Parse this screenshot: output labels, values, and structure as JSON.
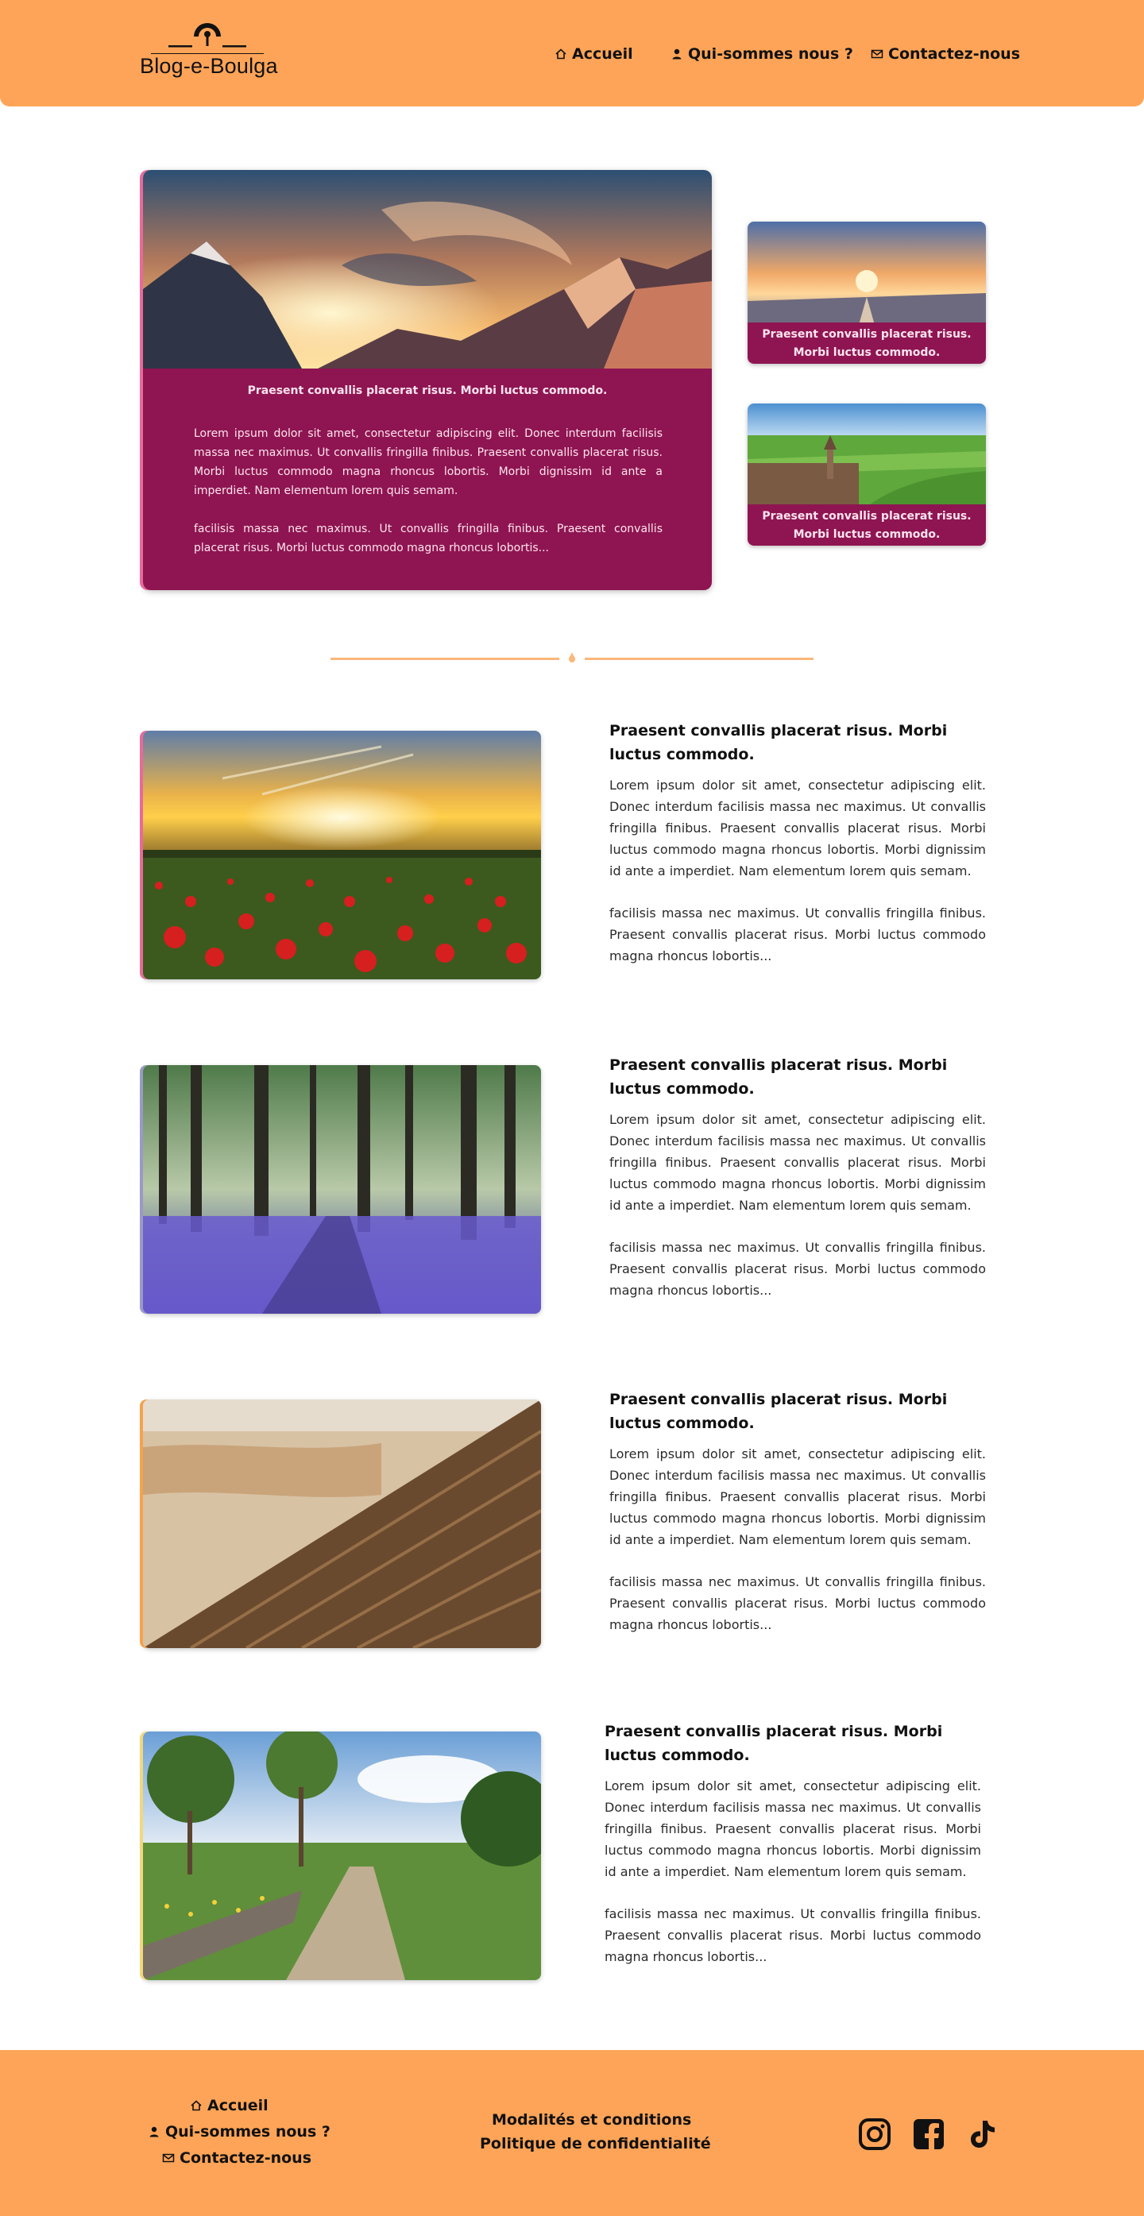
{
  "header": {
    "logo_text": "Blog-e-Boulga",
    "nav": [
      {
        "label": "Accueil",
        "icon": "home-icon"
      },
      {
        "label": "Qui-sommes nous ?",
        "icon": "user-icon"
      },
      {
        "label": "Contactez-nous",
        "icon": "mail-icon"
      }
    ]
  },
  "hero": {
    "title": "Praesent convallis placerat risus. Morbi luctus commodo.",
    "paragraph1": "Lorem ipsum dolor sit amet, consectetur adipiscing elit. Donec interdum facilisis massa nec maximus. Ut convallis fringilla finibus. Praesent convallis placerat risus. Morbi luctus commodo magna rhoncus lobortis. Morbi dignissim id ante a imperdiet. Nam elementum lorem quis semam.",
    "paragraph2": "facilisis massa nec maximus. Ut convallis fringilla finibus. Praesent convallis placerat risus. Morbi luctus commodo magna rhoncus lobortis..."
  },
  "side_cards": [
    {
      "caption": "Praesent convallis placerat risus. Morbi luctus commodo."
    },
    {
      "caption": "Praesent convallis placerat risus. Morbi luctus commodo."
    }
  ],
  "articles": [
    {
      "title": "Praesent convallis placerat risus. Morbi luctus commodo.",
      "paragraph1": "Lorem ipsum dolor sit amet, consectetur adipiscing elit. Donec interdum facilisis massa nec maximus. Ut convallis fringilla finibus. Praesent convallis placerat risus. Morbi luctus commodo magna rhoncus lobortis. Morbi dignissim id ante a imperdiet. Nam elementum lorem quis semam.",
      "paragraph2": "facilisis massa nec maximus. Ut convallis fringilla finibus. Praesent convallis placerat risus. Morbi luctus commodo magna rhoncus lobortis..."
    },
    {
      "title": "Praesent convallis placerat risus. Morbi luctus commodo.",
      "paragraph1": "Lorem ipsum dolor sit amet, consectetur adipiscing elit. Donec interdum facilisis massa nec maximus. Ut convallis fringilla finibus. Praesent convallis placerat risus. Morbi luctus commodo magna rhoncus lobortis. Morbi dignissim id ante a imperdiet. Nam elementum lorem quis semam.",
      "paragraph2": "facilisis massa nec maximus. Ut convallis fringilla finibus. Praesent convallis placerat risus. Morbi luctus commodo magna rhoncus lobortis..."
    },
    {
      "title": "Praesent convallis placerat risus. Morbi luctus commodo.",
      "paragraph1": "Lorem ipsum dolor sit amet, consectetur adipiscing elit. Donec interdum facilisis massa nec maximus. Ut convallis fringilla finibus. Praesent convallis placerat risus. Morbi luctus commodo magna rhoncus lobortis. Morbi dignissim id ante a imperdiet. Nam elementum lorem quis semam.",
      "paragraph2": "facilisis massa nec maximus. Ut convallis fringilla finibus. Praesent convallis placerat risus. Morbi luctus commodo magna rhoncus lobortis..."
    },
    {
      "title": "Praesent convallis placerat risus. Morbi luctus commodo.",
      "paragraph1": "Lorem ipsum dolor sit amet, consectetur adipiscing elit. Donec interdum facilisis massa nec maximus. Ut convallis fringilla finibus. Praesent convallis placerat risus. Morbi luctus commodo magna rhoncus lobortis. Morbi dignissim id ante a imperdiet. Nam elementum lorem quis semam.",
      "paragraph2": "facilisis massa nec maximus. Ut convallis fringilla finibus. Praesent convallis placerat risus. Morbi luctus commodo magna rhoncus lobortis..."
    }
  ],
  "footer": {
    "nav": [
      {
        "label": "Accueil",
        "icon": "home-icon"
      },
      {
        "label": "Qui-sommes nous ?",
        "icon": "user-icon"
      },
      {
        "label": "Contactez-nous",
        "icon": "mail-icon"
      }
    ],
    "legal": [
      "Modalités et conditions",
      "Politique de confidentialité"
    ],
    "social": [
      "instagram-icon",
      "facebook-icon",
      "tiktok-icon"
    ]
  },
  "colors": {
    "header_bg": "#fea458",
    "accent_magenta": "#8e1552",
    "divider": "#fcb77a"
  }
}
